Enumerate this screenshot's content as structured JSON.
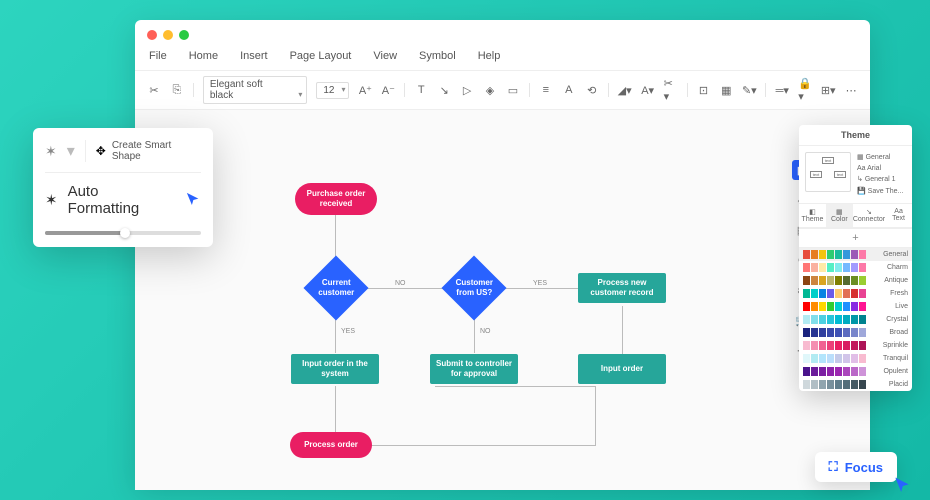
{
  "menu": {
    "file": "File",
    "home": "Home",
    "insert": "Insert",
    "pagelayout": "Page Layout",
    "view": "View",
    "symbol": "Symbol",
    "help": "Help"
  },
  "toolbar": {
    "font": "Elegant soft black",
    "size": "12"
  },
  "flowchart": {
    "n1": "Purchase order received",
    "n2": "Current customer",
    "n3": "Customer from US?",
    "n4": "Process new customer record",
    "n5": "Input order in the system",
    "n6": "Submit to controller for approval",
    "n7": "Input order",
    "n8": "Process order",
    "no": "NO",
    "yes": "YES"
  },
  "popup": {
    "smart": "Create Smart",
    "shape": "Shape",
    "auto": "Auto Formatting"
  },
  "theme": {
    "title": "Theme",
    "opts": {
      "general": "General",
      "arial": "Arial",
      "general1": "General 1",
      "save": "Save The..."
    },
    "tabs": {
      "theme": "Theme",
      "color": "Color",
      "connector": "Connector",
      "text": "Text"
    },
    "palettes": [
      "General",
      "Charm",
      "Antique",
      "Fresh",
      "Live",
      "Crystal",
      "Broad",
      "Sprinkle",
      "Tranquil",
      "Opulent",
      "Placid"
    ],
    "colors": {
      "General": [
        "#e74c3c",
        "#e67e22",
        "#f1c40f",
        "#2ecc71",
        "#1abc9c",
        "#3498db",
        "#9b59b6",
        "#fd79a8"
      ],
      "Charm": [
        "#ff7675",
        "#fab1a0",
        "#ffeaa7",
        "#55efc4",
        "#81ecec",
        "#74b9ff",
        "#a29bfe",
        "#fd79a8"
      ],
      "Antique": [
        "#8b4513",
        "#cd853f",
        "#daa520",
        "#bdb76b",
        "#808000",
        "#556b2f",
        "#6b8e23",
        "#9acd32"
      ],
      "Fresh": [
        "#00b894",
        "#00cec9",
        "#0984e3",
        "#6c5ce7",
        "#fdcb6e",
        "#e17055",
        "#d63031",
        "#e84393"
      ],
      "Live": [
        "#ff0000",
        "#ff8c00",
        "#ffd700",
        "#32cd32",
        "#00ced1",
        "#1e90ff",
        "#8a2be2",
        "#ff1493"
      ],
      "Crystal": [
        "#b2ebf2",
        "#80deea",
        "#4dd0e1",
        "#26c6da",
        "#00bcd4",
        "#00acc1",
        "#0097a7",
        "#00838f"
      ],
      "Broad": [
        "#1a237e",
        "#283593",
        "#303f9f",
        "#3949ab",
        "#3f51b5",
        "#5c6bc0",
        "#7986cb",
        "#9fa8da"
      ],
      "Sprinkle": [
        "#f8bbd0",
        "#f48fb1",
        "#f06292",
        "#ec407a",
        "#e91e63",
        "#d81b60",
        "#c2185b",
        "#ad1457"
      ],
      "Tranquil": [
        "#e0f7fa",
        "#b2ebf2",
        "#b3e5fc",
        "#bbdefb",
        "#c5cae9",
        "#d1c4e9",
        "#e1bee7",
        "#f8bbd0"
      ],
      "Opulent": [
        "#4a148c",
        "#6a1b9a",
        "#7b1fa2",
        "#8e24aa",
        "#9c27b0",
        "#ab47bc",
        "#ba68c8",
        "#ce93d8"
      ],
      "Placid": [
        "#cfd8dc",
        "#b0bec5",
        "#90a4ae",
        "#78909c",
        "#607d8b",
        "#546e7a",
        "#455a64",
        "#37474f"
      ]
    }
  },
  "focus": "Focus"
}
